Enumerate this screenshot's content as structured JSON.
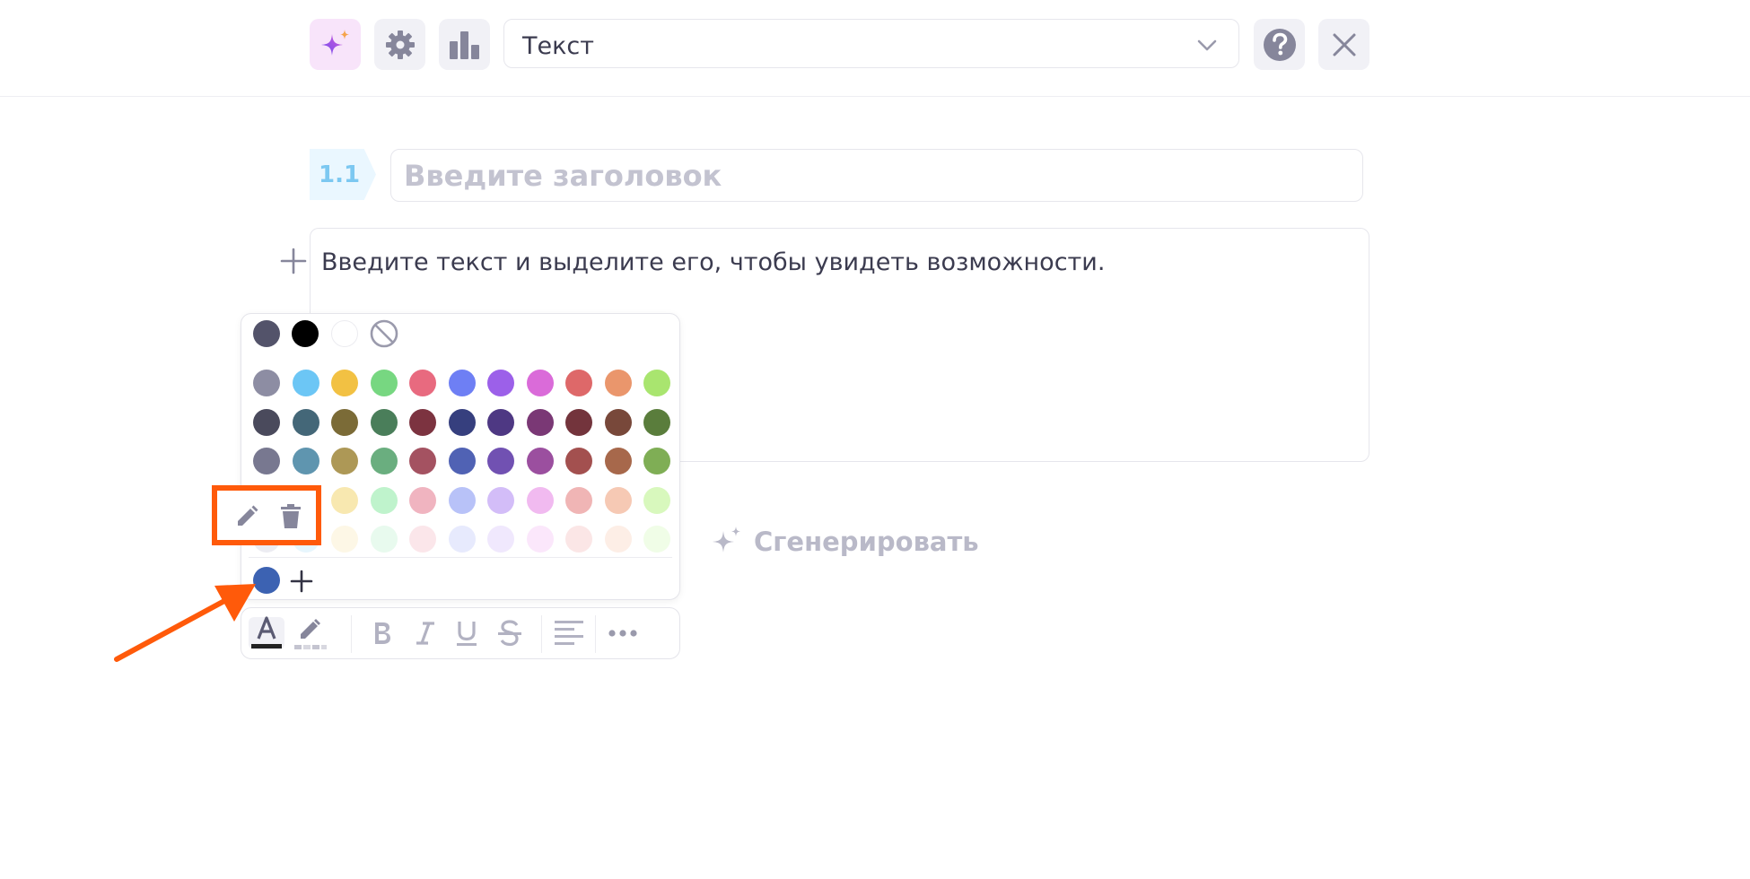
{
  "toolbar": {
    "ai_icon": "sparkles-icon",
    "settings_icon": "gear-icon",
    "stats_icon": "bar-chart-icon",
    "block_type": "Текст",
    "block_type_icon": "chevron-down-icon",
    "help_icon": "question-icon",
    "close_icon": "close-icon"
  },
  "section": {
    "number": "1.1",
    "title_placeholder": "Введите заголовок",
    "title_value": "",
    "body_text": "Введите текст и выделите его, чтобы увидеть возможности."
  },
  "generate": {
    "label": "Сгенерировать",
    "icon": "sparkles-icon"
  },
  "color_palette": {
    "top_row": [
      "#53536a",
      "#000000",
      "#ffffff",
      "no-color"
    ],
    "grid": [
      [
        "#8d8da3",
        "#6cc6f5",
        "#f2c143",
        "#77d781",
        "#e86a7f",
        "#6e7ff4",
        "#9c60e9",
        "#da6bd9",
        "#de6869",
        "#ea966c",
        "#a9e56f"
      ],
      [
        "#4a4a5c",
        "#446778",
        "#7b6b37",
        "#4a7e5a",
        "#7c3340",
        "#363f7e",
        "#4e3883",
        "#7a3875",
        "#73343c",
        "#78483a",
        "#5a7d3c"
      ],
      [
        "#787890",
        "#5f95af",
        "#ad9856",
        "#6aae7f",
        "#a45261",
        "#5062b4",
        "#7151b2",
        "#9b4f9f",
        "#a3504f",
        "#a7684b",
        "#7fae55"
      ],
      [
        "#c3c3d1",
        "#b5e2f8",
        "#f8e8b0",
        "#bff3cc",
        "#f0b4c0",
        "#b8c2f8",
        "#d3bdf8",
        "#f1baf0",
        "#f0b5b5",
        "#f6c9b4",
        "#d8f8bd"
      ],
      [
        "#ececf2",
        "#e7f6fd",
        "#fdf7e6",
        "#e8faee",
        "#fbe6ea",
        "#e7eafd",
        "#f0e8fd",
        "#fbe7fb",
        "#fbe6e6",
        "#fdeee6",
        "#f0fde7"
      ]
    ],
    "custom_colors": [
      "#3c62b2"
    ],
    "add_icon": "plus-icon",
    "edit_icon": "pencil-icon",
    "delete_icon": "trash-icon"
  },
  "formatting": {
    "text_color_icon": "text-color-icon",
    "text_color": "#222222",
    "highlight_icon": "highlighter-icon",
    "bold_icon": "bold-icon",
    "italic_icon": "italic-icon",
    "underline_icon": "underline-icon",
    "strike_icon": "strikethrough-icon",
    "align_icon": "align-left-icon",
    "more_icon": "more-icon"
  },
  "annotation_colors": {
    "accent": "#ff5a0a"
  }
}
